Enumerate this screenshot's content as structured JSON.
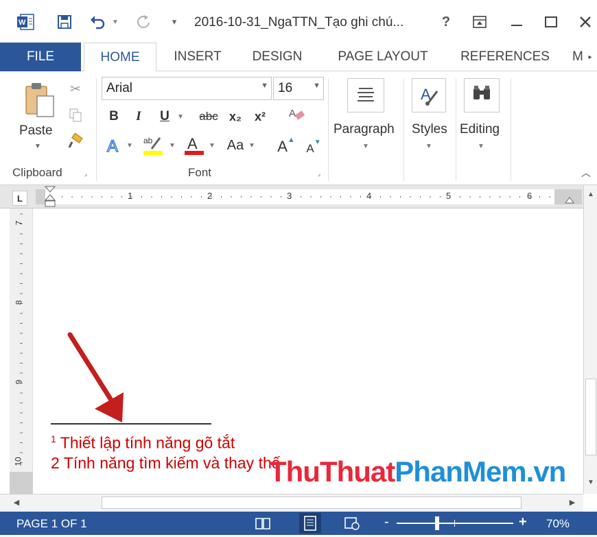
{
  "window": {
    "title": "2016-10-31_NgaTTN_Tạo ghi chú...",
    "help": "?"
  },
  "tabs": [
    {
      "label": "FILE"
    },
    {
      "label": "HOME"
    },
    {
      "label": "INSERT"
    },
    {
      "label": "DESIGN"
    },
    {
      "label": "PAGE LAYOUT"
    },
    {
      "label": "REFERENCES"
    },
    {
      "label": "M"
    }
  ],
  "ribbon": {
    "clipboard": {
      "paste_label": "Paste",
      "group_label": "Clipboard"
    },
    "font": {
      "font_name": "Arial",
      "font_size": "16",
      "group_label": "Font",
      "bold": "B",
      "italic": "I",
      "underline": "U",
      "strike": "abc",
      "subscript": "x₂",
      "superscript": "x²",
      "change_case": "Aa",
      "grow": "A",
      "shrink": "A"
    },
    "paragraph_label": "Paragraph",
    "styles_label": "Styles",
    "editing_label": "Editing"
  },
  "ruler": {
    "marks": [
      "1",
      "2",
      "3",
      "4",
      "5",
      "6"
    ],
    "vmarks": [
      "7",
      "8",
      "9",
      "10"
    ]
  },
  "document": {
    "footnotes": [
      {
        "marker": "1",
        "text": "Thiết lập tính năng gõ tắt"
      },
      {
        "marker": "2",
        "text": "Tính năng tìm kiếm và thay thế"
      }
    ]
  },
  "watermark": {
    "part1": "ThuThuat",
    "part2": "PhanMem",
    "part3": ".vn"
  },
  "statusbar": {
    "page": "PAGE 1 OF 1",
    "zoom": "70%",
    "zoom_minus": "-",
    "zoom_plus": "+"
  },
  "colors": {
    "accent": "#2b579a",
    "footnote": "#cc0000",
    "watermark_red": "#e8283c",
    "watermark_blue": "#1f8fd8"
  }
}
